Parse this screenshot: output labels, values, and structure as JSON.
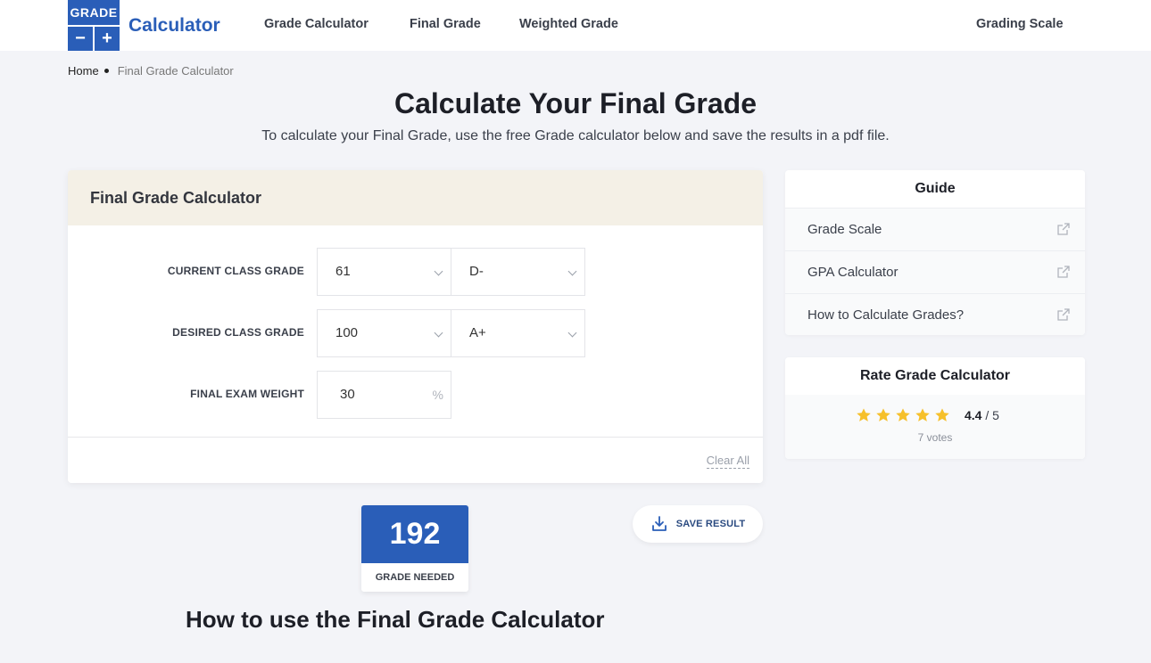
{
  "header": {
    "logo_top": "GRADE",
    "logo_minus": "−",
    "logo_plus": "+",
    "logo_text": "Calculator",
    "nav": [
      "Grade Calculator",
      "Final Grade",
      "Weighted Grade",
      "Grading Scale"
    ]
  },
  "breadcrumb": {
    "home": "Home",
    "current": "Final Grade Calculator"
  },
  "page": {
    "title": "Calculate Your Final Grade",
    "subtitle": "To calculate your Final Grade, use the free Grade calculator below and save the results in a pdf file."
  },
  "calculator": {
    "title": "Final Grade Calculator",
    "rows": [
      {
        "label": "CURRENT CLASS GRADE",
        "value": "61",
        "letter": "D-"
      },
      {
        "label": "DESIRED CLASS GRADE",
        "value": "100",
        "letter": "A+"
      },
      {
        "label": "FINAL EXAM WEIGHT",
        "value": "30",
        "unit": "%"
      }
    ],
    "clear_all": "Clear All"
  },
  "result": {
    "value": "192",
    "label": "GRADE NEEDED"
  },
  "save_button": "SAVE RESULT",
  "howto_title": "How to use the Final Grade Calculator",
  "guide": {
    "title": "Guide",
    "items": [
      "Grade Scale",
      "GPA Calculator",
      "How to Calculate Grades?"
    ]
  },
  "rate": {
    "title": "Rate Grade Calculator",
    "score": "4.4",
    "max": "/ 5",
    "votes": "7 votes",
    "stars": 5,
    "star_color": "#f6c02b"
  },
  "colors": {
    "brand": "#2a5eb8",
    "card_header": "#f4f0e6",
    "background": "#f3f4f8"
  }
}
